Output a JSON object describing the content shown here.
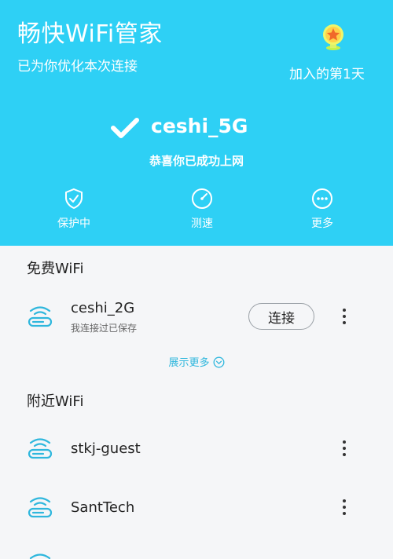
{
  "header": {
    "app_title": "畅快WiFi管家",
    "subtitle": "已为你优化本次连接",
    "joined_text": "加入的第1天",
    "badge_icon": "trophy-star-icon",
    "connected_ssid": "ceshi_5G",
    "congrats": "恭喜你已成功上网",
    "actions": [
      {
        "label": "保护中",
        "icon": "shield-check-icon"
      },
      {
        "label": "测速",
        "icon": "speedometer-icon"
      },
      {
        "label": "更多",
        "icon": "more-dots-icon"
      }
    ]
  },
  "free_wifi": {
    "title": "免费WiFi",
    "items": [
      {
        "name": "ceshi_2G",
        "status": "我连接过已保存",
        "button": "连接"
      }
    ],
    "show_more": "展示更多"
  },
  "nearby_wifi": {
    "title": "附近WiFi",
    "items": [
      {
        "name": "stkj-guest"
      },
      {
        "name": "SantTech"
      }
    ]
  },
  "colors": {
    "header_bg": "#2ed0f5",
    "accent": "#2fb7dd",
    "page_bg": "#f5f6f8"
  }
}
